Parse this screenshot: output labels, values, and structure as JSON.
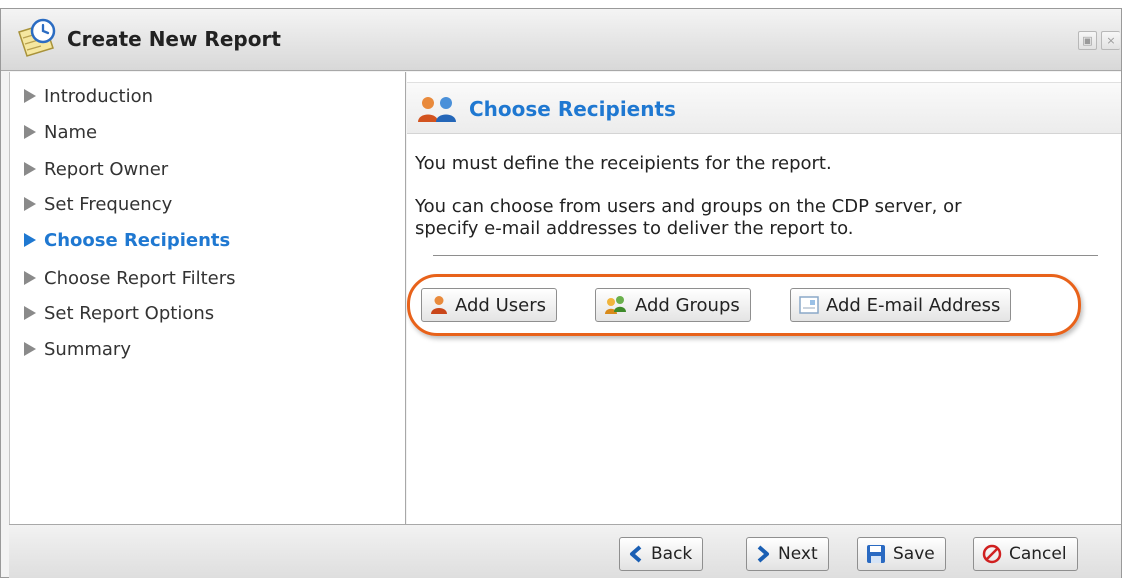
{
  "window": {
    "title": "Create New Report",
    "title_icon": "report-clock-icon",
    "controls": [
      {
        "name": "maximize-icon",
        "glyph": "▣"
      },
      {
        "name": "close-icon",
        "glyph": "×"
      }
    ]
  },
  "nav": {
    "items": [
      {
        "label": "Introduction",
        "active": false
      },
      {
        "label": "Name",
        "active": false
      },
      {
        "label": "Report Owner",
        "active": false
      },
      {
        "label": "Set Frequency",
        "active": false
      },
      {
        "label": "Choose Recipients",
        "active": true
      },
      {
        "label": "Choose Report Filters",
        "active": false
      },
      {
        "label": "Set Report Options",
        "active": false
      },
      {
        "label": "Summary",
        "active": false
      }
    ]
  },
  "content": {
    "header_title": "Choose Recipients",
    "header_icon": "users-icon",
    "paragraph1": "You must define the receipients for the report.",
    "paragraph2_line1": "You can choose from users and groups on the CDP server, or",
    "paragraph2_line2": "specify e-mail addresses to deliver the report to.",
    "buttons": {
      "add_users": "Add Users",
      "add_groups": "Add Groups",
      "add_email": "Add E-mail Address"
    }
  },
  "footer": {
    "back": "Back",
    "next": "Next",
    "save": "Save",
    "cancel": "Cancel"
  },
  "colors": {
    "accent": "#1f78d1",
    "highlight": "#e8621a"
  }
}
